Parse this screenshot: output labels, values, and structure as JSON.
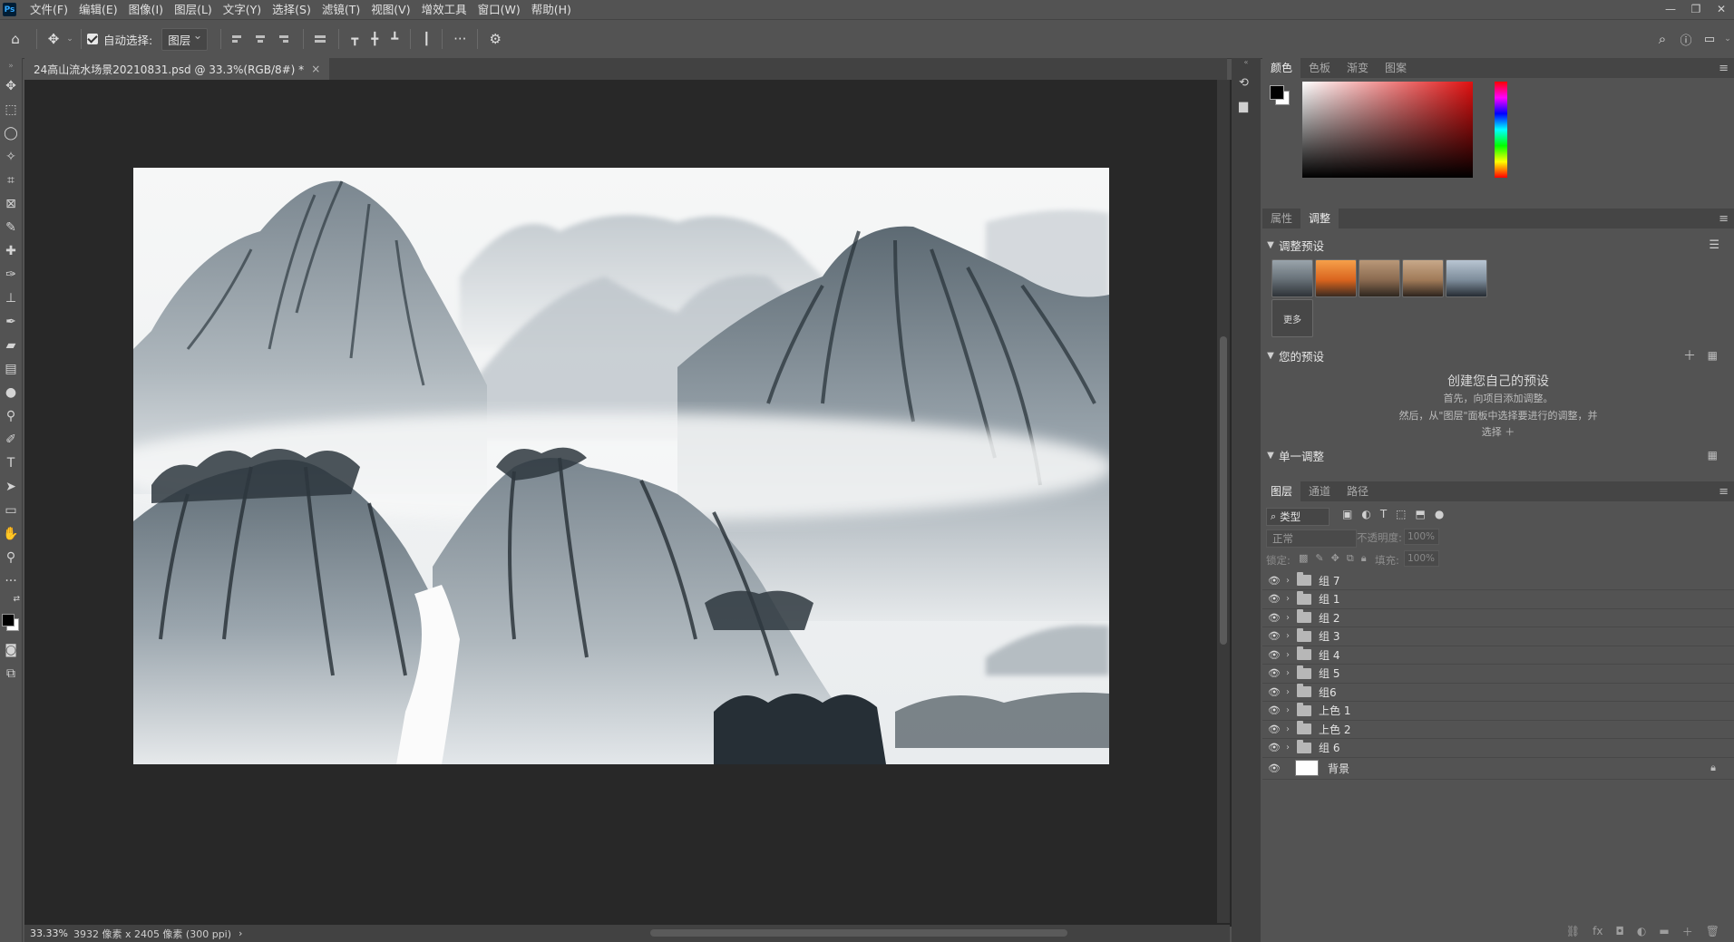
{
  "menubar": {
    "logo": "Ps",
    "items": [
      "文件(F)",
      "编辑(E)",
      "图像(I)",
      "图层(L)",
      "文字(Y)",
      "选择(S)",
      "滤镜(T)",
      "视图(V)",
      "增效工具",
      "窗口(W)",
      "帮助(H)"
    ],
    "window_controls": [
      "—",
      "❐",
      "✕"
    ]
  },
  "options_bar": {
    "auto_select_label": "自动选择:",
    "auto_select_checked": true,
    "target_value": "图层",
    "more_label": "···"
  },
  "document": {
    "tab_title": "24高山流水场景20210831.psd @ 33.3%(RGB/8#) *",
    "close_glyph": "×"
  },
  "status_bar": {
    "zoom": "33.33%",
    "info": "3932 像素 x 2405 像素 (300 ppi)",
    "arrow": "›"
  },
  "color_panel": {
    "tabs": [
      "颜色",
      "色板",
      "渐变",
      "图案"
    ],
    "active_tab": "颜色",
    "foreground": "#000000",
    "background": "#ffffff",
    "hue_color": "#e01010"
  },
  "adjustments_panel": {
    "tabs": [
      "属性",
      "调整"
    ],
    "active_tab": "调整",
    "presets_header": "调整预设",
    "more_label": "更多",
    "your_presets_header": "您的预设",
    "create_title": "创建您自己的预设",
    "create_line1": "首先，向项目添加调整。",
    "create_line2": "然后，从\"图层\"面板中选择要进行的调整，并",
    "create_line3": "选择 ＋",
    "single_adjust_header": "单一调整"
  },
  "layers_panel": {
    "tabs": [
      "图层",
      "通道",
      "路径"
    ],
    "active_tab": "图层",
    "filter_label": "类型",
    "blend_mode": "正常",
    "opacity_label": "不透明度:",
    "opacity_value": "100%",
    "lock_label": "锁定:",
    "fill_label": "填充:",
    "fill_value": "100%",
    "layers": [
      {
        "name": "组 7",
        "type": "group"
      },
      {
        "name": "组 1",
        "type": "group"
      },
      {
        "name": "组 2",
        "type": "group"
      },
      {
        "name": "组 3",
        "type": "group"
      },
      {
        "name": "组 4",
        "type": "group"
      },
      {
        "name": "组 5",
        "type": "group"
      },
      {
        "name": "组6",
        "type": "group"
      },
      {
        "name": "上色 1",
        "type": "group"
      },
      {
        "name": "上色 2",
        "type": "group"
      },
      {
        "name": "组 6",
        "type": "group"
      },
      {
        "name": "背景",
        "type": "background"
      }
    ],
    "footer_icons": [
      "link-icon",
      "fx-icon",
      "mask-icon",
      "adjustment-icon",
      "folder-icon",
      "new-layer-icon",
      "trash-icon"
    ]
  },
  "colors": {
    "chrome": "#535353",
    "canvas_bg": "#282828",
    "ink": "#3d4850"
  }
}
